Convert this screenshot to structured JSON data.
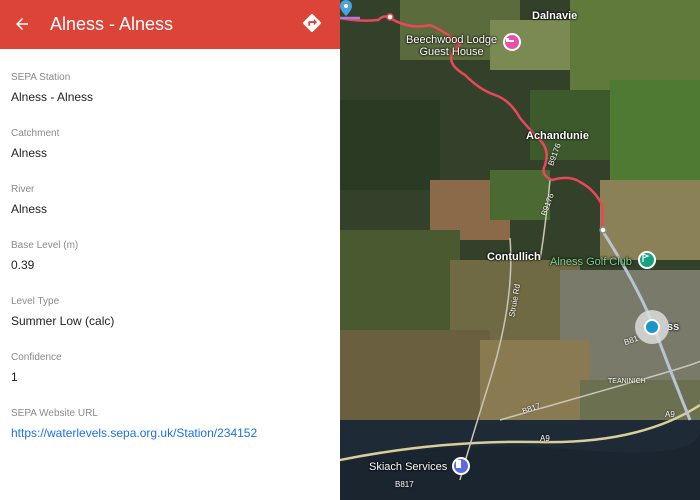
{
  "header": {
    "title": "Alness - Alness",
    "back_icon": "arrow-left-icon",
    "directions_icon": "directions-icon",
    "color": "#db4437"
  },
  "fields": [
    {
      "label": "SEPA Station",
      "value": "Alness - Alness"
    },
    {
      "label": "Catchment",
      "value": "Alness"
    },
    {
      "label": "River",
      "value": "Alness"
    },
    {
      "label": "Base Level (m)",
      "value": "0.39"
    },
    {
      "label": "Level Type",
      "value": "Summer Low (calc)"
    },
    {
      "label": "Confidence",
      "value": "1"
    },
    {
      "label": "SEPA Website URL",
      "value": "https://waterlevels.sepa.org.uk/Station/234152",
      "is_link": true
    }
  ],
  "map": {
    "labels": {
      "dalnavie": "Dalnavie",
      "beechwood": "Beechwood Lodge\nGuest House",
      "achandunie": "Achandunie",
      "contullich": "Contullich",
      "golf": "Alness Golf Club",
      "town": "ss",
      "teaninich": "TEANINICH",
      "skiach": "Skiach Services"
    },
    "roads": {
      "b9176a": "B9176",
      "b9176b": "B9176",
      "struie": "Struie Rd",
      "b817a": "B817",
      "b817b": "B817",
      "a9": "A9",
      "b81": "B81",
      "a9b": "A9"
    },
    "river_color": "#e8485a",
    "poi_icons": [
      "hotel-icon",
      "golf-icon",
      "fuel-icon",
      "water-station-icon",
      "map-pin-icon"
    ]
  }
}
